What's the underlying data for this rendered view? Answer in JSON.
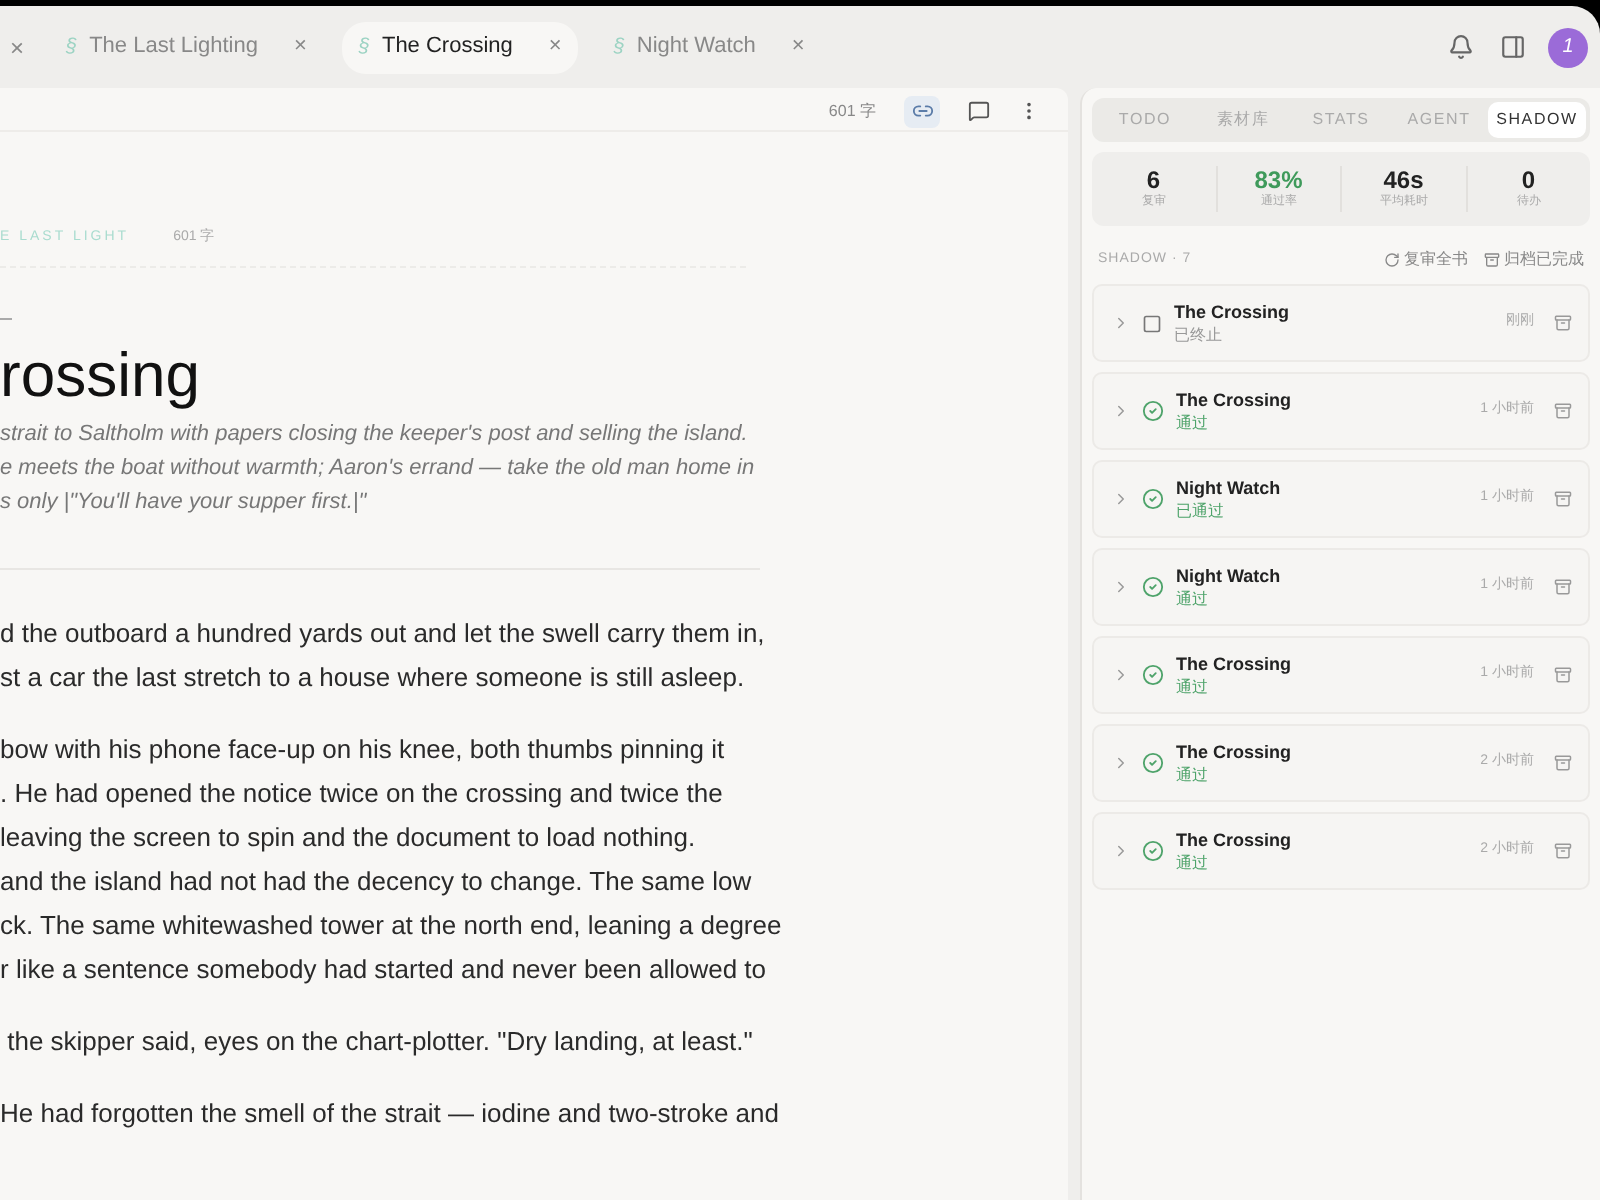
{
  "tabs": [
    {
      "icon": "§",
      "label": "The Last Lighting",
      "close": "×",
      "selected": false
    },
    {
      "icon": "§",
      "label": "The Crossing",
      "close": "×",
      "selected": true
    },
    {
      "icon": "§",
      "label": "Night Watch",
      "close": "×",
      "selected": false
    }
  ],
  "leading_close": "×",
  "avatar": "1",
  "editor": {
    "word_count": "601 字",
    "link_active": true,
    "breadcrumb": "E LAST LIGHT",
    "breadcrumb_count": "601 字",
    "title": "rossing",
    "summary": [
      "strait to Saltholm with papers closing the keeper's post and selling the island.",
      "e meets the boat without warmth; Aaron's errand — take the old man home in",
      "s only |\"You'll have your supper first.|\""
    ],
    "paragraphs": [
      [
        "d the outboard a hundred yards out and let the swell carry them in,",
        "st a car the last stretch to a house where someone is still asleep."
      ],
      [
        "bow with his phone face-up on his knee, both thumbs pinning it",
        ". He had opened the notice twice on the crossing and twice the",
        "leaving the screen to spin and the document to load nothing.",
        "and the island had not had the decency to change. The same low",
        "ck. The same whitewashed tower at the north end, leaning a degree",
        "r like a sentence somebody had started and never been allowed to"
      ],
      [
        " the skipper said, eyes on the chart-plotter. \"Dry landing, at least.\""
      ],
      [
        "He had forgotten the smell of the strait — iodine and two-stroke and"
      ]
    ]
  },
  "panel": {
    "tabs": [
      {
        "label": "TODO",
        "selected": false
      },
      {
        "label": "素材库",
        "selected": false
      },
      {
        "label": "STATS",
        "selected": false
      },
      {
        "label": "AGENT",
        "selected": false
      },
      {
        "label": "SHADOW",
        "selected": true
      }
    ],
    "stats": [
      {
        "value": "6",
        "label": "复审",
        "kind": "plain"
      },
      {
        "value": "83%",
        "label": "通过率",
        "kind": "good"
      },
      {
        "value": "46s",
        "label": "平均耗时",
        "kind": "plain"
      },
      {
        "value": "0",
        "label": "待办",
        "kind": "plain"
      }
    ],
    "list_title": "SHADOW · 7",
    "actions": [
      {
        "label": "复审全书",
        "kind": "refresh"
      },
      {
        "label": "归档已完成",
        "kind": "archive"
      }
    ],
    "items": [
      {
        "title": "The Crossing",
        "status": "已终止",
        "kind": "stopped",
        "time": "刚刚"
      },
      {
        "title": "The Crossing",
        "status": "通过",
        "kind": "passed",
        "time": "1 小时前"
      },
      {
        "title": "Night Watch",
        "status": "已通过",
        "kind": "passed",
        "time": "1 小时前"
      },
      {
        "title": "Night Watch",
        "status": "通过",
        "kind": "passed",
        "time": "1 小时前"
      },
      {
        "title": "The Crossing",
        "status": "通过",
        "kind": "passed",
        "time": "1 小时前"
      },
      {
        "title": "The Crossing",
        "status": "通过",
        "kind": "passed",
        "time": "2 小时前"
      },
      {
        "title": "The Crossing",
        "status": "通过",
        "kind": "passed",
        "time": "2 小时前"
      }
    ]
  }
}
